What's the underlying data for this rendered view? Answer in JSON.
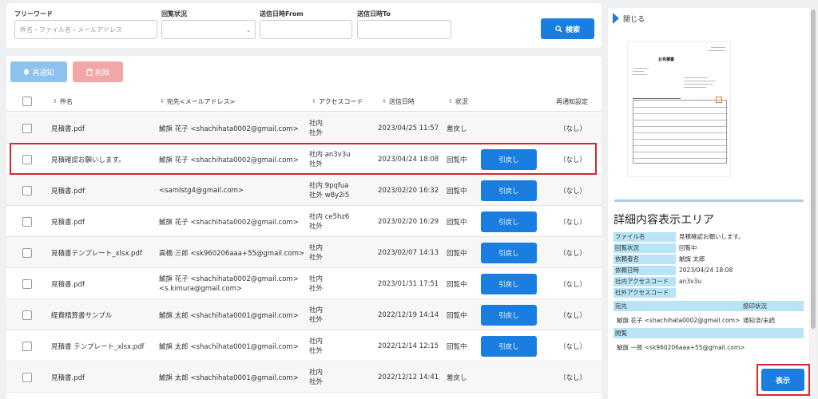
{
  "search": {
    "freeword_label": "フリーワード",
    "freeword_placeholder": "件名・ファイル名・メールアドレス",
    "status_label": "回覧状況",
    "status_value": "",
    "from_label": "送信日時From",
    "to_label": "送信日時To",
    "search_button": "検索"
  },
  "toolbar": {
    "renotify_button": "再通知",
    "delete_button": "削除"
  },
  "columns": {
    "subject": "件名",
    "recipient": "宛先<メールアドレス>",
    "access_code": "アクセスコード",
    "sent_at": "送信日時",
    "status": "状況",
    "renotify": "再通知設定"
  },
  "rows": [
    {
      "subject": "見積書.pdf",
      "recipient": [
        "鯱旗 花子 <shachihata0002@gmail.com>"
      ],
      "code_in": "社内",
      "code_out": "社外",
      "sent": "2023/04/25 11:57",
      "status": "差戻し",
      "action": "",
      "renotify": "（なし）"
    },
    {
      "subject": "見積確認お願いします。",
      "recipient": [
        "鯱旗 花子 <shachihata0002@gmail.com>"
      ],
      "code_in": "社内 an3v3u",
      "code_out": "社外",
      "sent": "2023/04/24 18:08",
      "status": "回覧中",
      "action": "引戻し",
      "renotify": "（なし）"
    },
    {
      "subject": "見積書.pdf",
      "recipient": [
        "<samlstg4@gmail.com>"
      ],
      "code_in": "社内 9pqfua",
      "code_out": "社外 w8y2i5",
      "sent": "2023/02/20 16:32",
      "status": "回覧中",
      "action": "引戻し",
      "renotify": "（なし）"
    },
    {
      "subject": "見積書.pdf",
      "recipient": [
        "鯱旗 花子 <shachihata0002@gmail.com>"
      ],
      "code_in": "社内 ce5hz6",
      "code_out": "社外",
      "sent": "2023/02/20 16:29",
      "status": "回覧中",
      "action": "引戻し",
      "renotify": "（なし）"
    },
    {
      "subject": "見積書テンプレート_xlsx.pdf",
      "recipient": [
        "高橋 三郎 <sk960206aaa+55@gmail.com>"
      ],
      "code_in": "社内",
      "code_out": "社外",
      "sent": "2023/02/07 14:13",
      "status": "回覧中",
      "action": "引戻し",
      "renotify": "（なし）"
    },
    {
      "subject": "見積書.pdf",
      "recipient": [
        "鯱旗 花子 <shachihata0002@gmail.com>",
        "<s.kimura@gmail.com>"
      ],
      "code_in": "社内",
      "code_out": "社外",
      "sent": "2023/01/31 17:51",
      "status": "回覧中",
      "action": "引戻し",
      "renotify": "（なし）"
    },
    {
      "subject": "経費精算書サンプル",
      "recipient": [
        "鯱旗 太郎 <shachihata0001@gmail.com>"
      ],
      "code_in": "社内",
      "code_out": "社外",
      "sent": "2022/12/19 14:14",
      "status": "回覧中",
      "action": "引戻し",
      "renotify": "（なし）"
    },
    {
      "subject": "見積書 テンプレート_xlsx.pdf",
      "recipient": [
        "鯱旗 太郎 <shachihata0001@gmail.com>"
      ],
      "code_in": "社内",
      "code_out": "社外",
      "sent": "2022/12/14 12:15",
      "status": "回覧中",
      "action": "引戻し",
      "renotify": "（なし）"
    },
    {
      "subject": "見積書.pdf",
      "recipient": [
        "鯱旗 太郎 <shachihata0001@gmail.com>"
      ],
      "code_in": "社内",
      "code_out": "社外",
      "sent": "2022/12/12 14:41",
      "status": "差戻し",
      "action": "",
      "renotify": "（なし）"
    }
  ],
  "right": {
    "close_label": "閉じる",
    "preview_title": "お見積書",
    "detail_title": "詳細内容表示エリア",
    "details": [
      {
        "key": "ファイル名",
        "value": "見積確認お願いします。"
      },
      {
        "key": "回覧状況",
        "value": "回覧中"
      },
      {
        "key": "依頼者名",
        "value": "鯱旗 太郎"
      },
      {
        "key": "依頼日時",
        "value": "2023/04/24 18:08"
      },
      {
        "key": "社内アクセスコード",
        "value": "an3v3u"
      },
      {
        "key": "社外アクセスコード",
        "value": ""
      }
    ],
    "dest_header": "宛先",
    "approval_header": "捺印状況",
    "dest_value": "鯱旗 花子 <shachihata0002@gmail.com>",
    "approval_value": "通知済/未読",
    "view_header": "閲覧",
    "view_value": "鯱旗 一郎 <sk960206aaa+55@gmail.com>",
    "show_button": "表示"
  },
  "colors": {
    "primary": "#1a7ee0",
    "highlight": "#d9262c",
    "key_bg": "#b9e4f7"
  }
}
